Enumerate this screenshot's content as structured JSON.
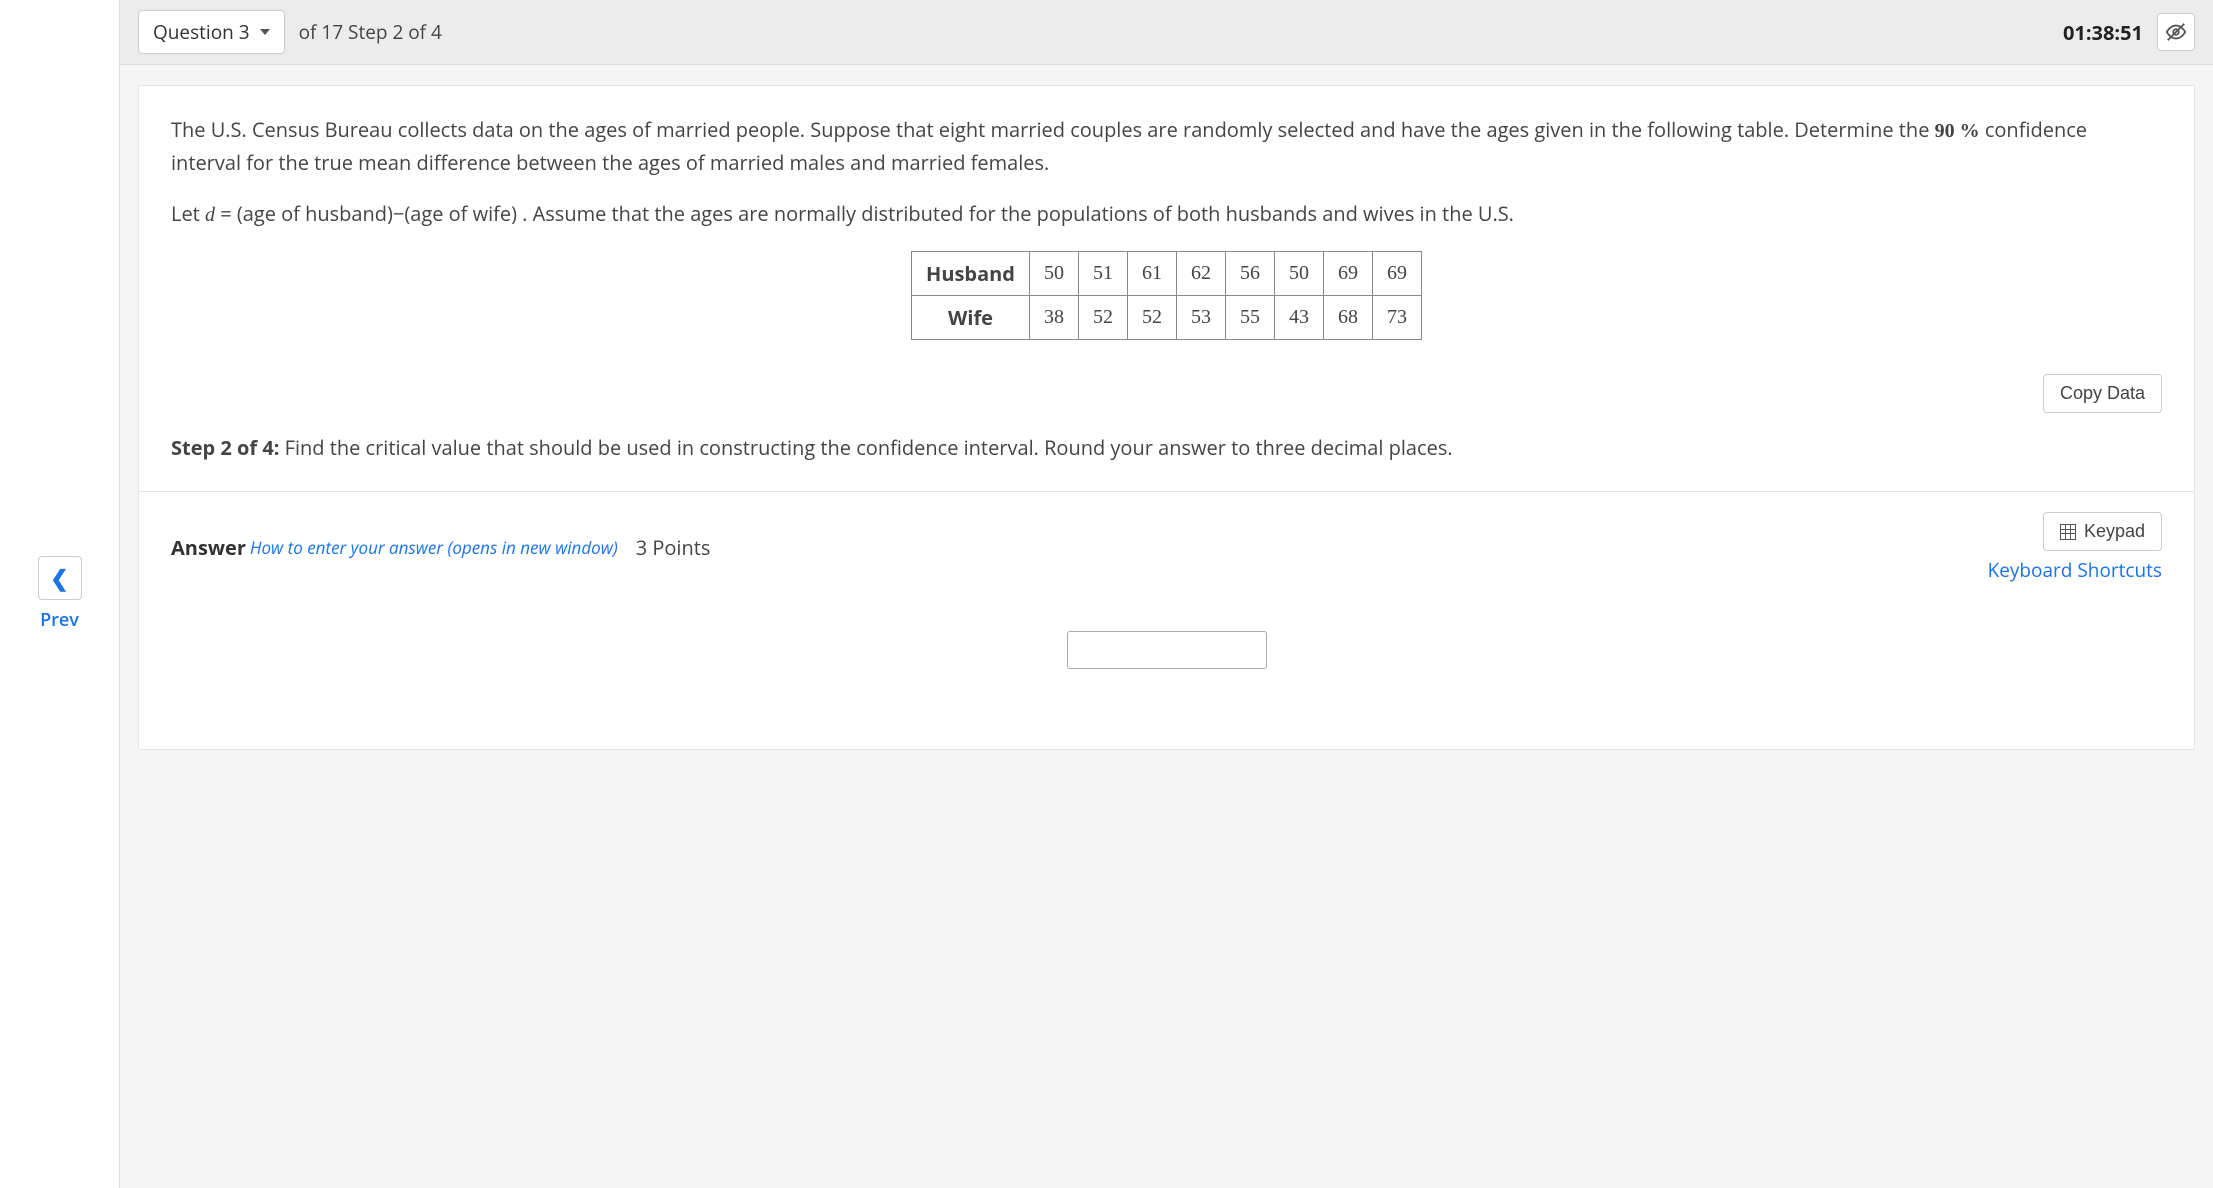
{
  "nav": {
    "prev_label": "Prev"
  },
  "header": {
    "question_label": "Question 3",
    "progress_text": "of 17 Step 2 of 4",
    "timer": "01:38:51"
  },
  "prompt": {
    "para1_a": "The U.S. Census Bureau collects data on the ages of married people. Suppose that eight married couples are randomly selected and have the ages given in the following table. Determine the ",
    "ci_pct": "90 %",
    "para1_b": " confidence interval for the true mean difference between the ages of married males and married females.",
    "para2_a": "Let ",
    "var": "d",
    "para2_b": " =  (age of husband)−(age of wife) . Assume that the ages are normally distributed for the populations of both husbands and wives in the U.S."
  },
  "table": {
    "row_labels": [
      "Husband",
      "Wife"
    ],
    "husband": [
      "50",
      "51",
      "61",
      "62",
      "56",
      "50",
      "69",
      "69"
    ],
    "wife": [
      "38",
      "52",
      "52",
      "53",
      "55",
      "43",
      "68",
      "73"
    ]
  },
  "buttons": {
    "copy_data": "Copy Data",
    "keypad": "Keypad"
  },
  "step": {
    "label": "Step 2 of 4:",
    "text": " Find the critical value that should be used in constructing the confidence interval. Round your answer to three decimal places."
  },
  "answer": {
    "label": "Answer",
    "help_link": "How to enter your answer (opens in new window)",
    "points": "3 Points",
    "keyboard_shortcuts": "Keyboard Shortcuts"
  }
}
